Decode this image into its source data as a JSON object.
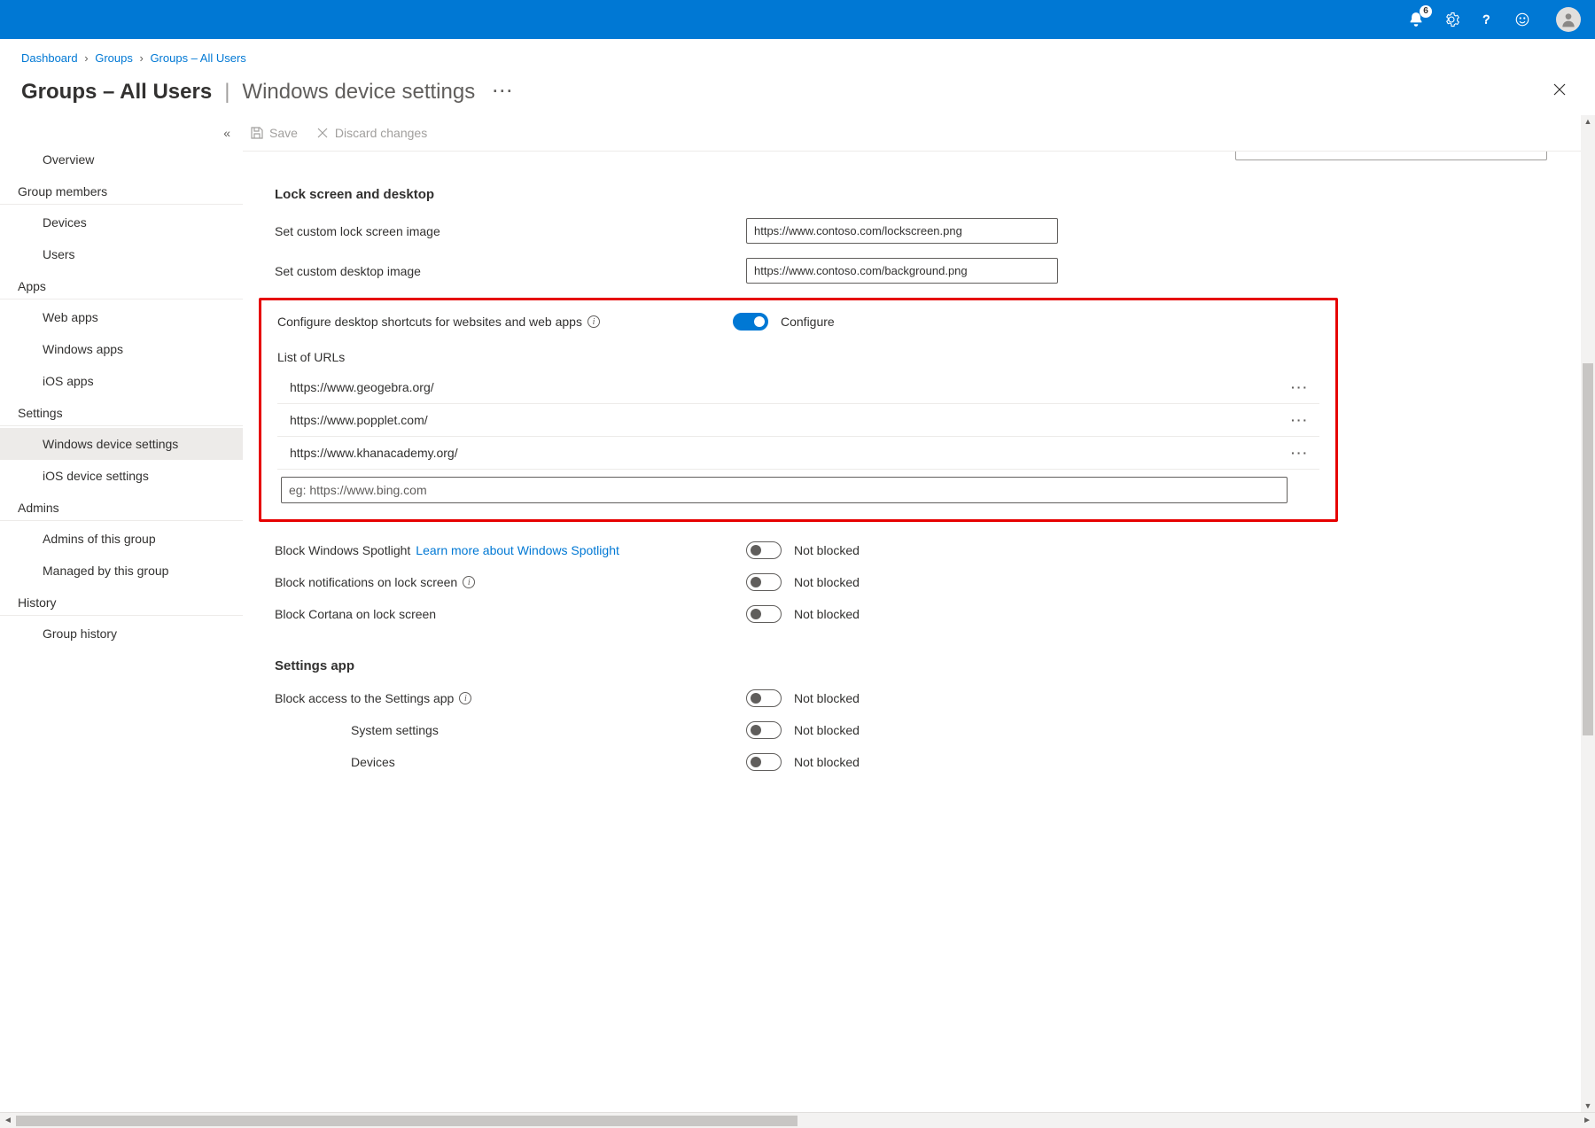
{
  "topbar": {
    "notification_count": "6"
  },
  "breadcrumb": {
    "items": [
      "Dashboard",
      "Groups",
      "Groups – All Users"
    ]
  },
  "page_title": {
    "bold": "Groups – All Users",
    "sep": "|",
    "light": "Windows device settings"
  },
  "cmd": {
    "save": "Save",
    "discard": "Discard changes"
  },
  "sidebar": {
    "collapse_glyph": "«",
    "overview": "Overview",
    "sections": {
      "group_members": {
        "label": "Group members",
        "items": [
          "Devices",
          "Users"
        ]
      },
      "apps": {
        "label": "Apps",
        "items": [
          "Web apps",
          "Windows apps",
          "iOS apps"
        ]
      },
      "settings": {
        "label": "Settings",
        "items": [
          "Windows device settings",
          "iOS device settings"
        ],
        "selected_index": 0
      },
      "admins": {
        "label": "Admins",
        "items": [
          "Admins of this group",
          "Managed by this group"
        ]
      },
      "history": {
        "label": "History",
        "items": [
          "Group history"
        ]
      }
    }
  },
  "content": {
    "section_lock_h": "Lock screen and desktop",
    "lockscreen_label": "Set custom lock screen image",
    "lockscreen_value": "https://www.contoso.com/lockscreen.png",
    "desktop_label": "Set custom desktop image",
    "desktop_value": "https://www.contoso.com/background.png",
    "shortcuts_label": "Configure desktop shortcuts for websites and web apps",
    "shortcuts_toggle_text": "Configure",
    "shortcuts_toggle_on": true,
    "list_label": "List of URLs",
    "urls": [
      "https://www.geogebra.org/",
      "https://www.popplet.com/",
      "https://www.khanacademy.org/"
    ],
    "url_placeholder": "eg: https://www.bing.com",
    "spotlight_label": "Block Windows Spotlight",
    "spotlight_link": "Learn more about Windows Spotlight",
    "notblocked": "Not blocked",
    "notif_label": "Block notifications on lock screen",
    "cortana_label": "Block Cortana on lock screen",
    "section_settings_h": "Settings app",
    "block_settings_label": "Block access to the Settings app",
    "system_settings_label": "System settings",
    "devices_label": "Devices"
  }
}
